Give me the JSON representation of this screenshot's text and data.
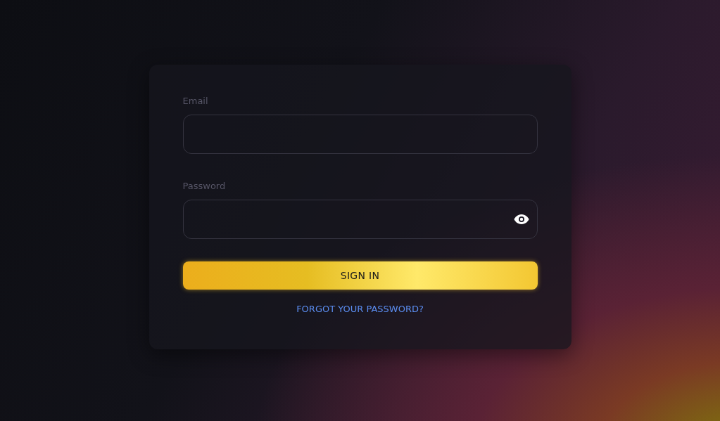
{
  "form": {
    "fields": [
      {
        "kind": "text",
        "label": "Email"
      },
      {
        "kind": "password",
        "label": "Password"
      }
    ],
    "submit": "SIGN IN",
    "forgot_link": "FORGOT YOUR PASSWORD?"
  }
}
